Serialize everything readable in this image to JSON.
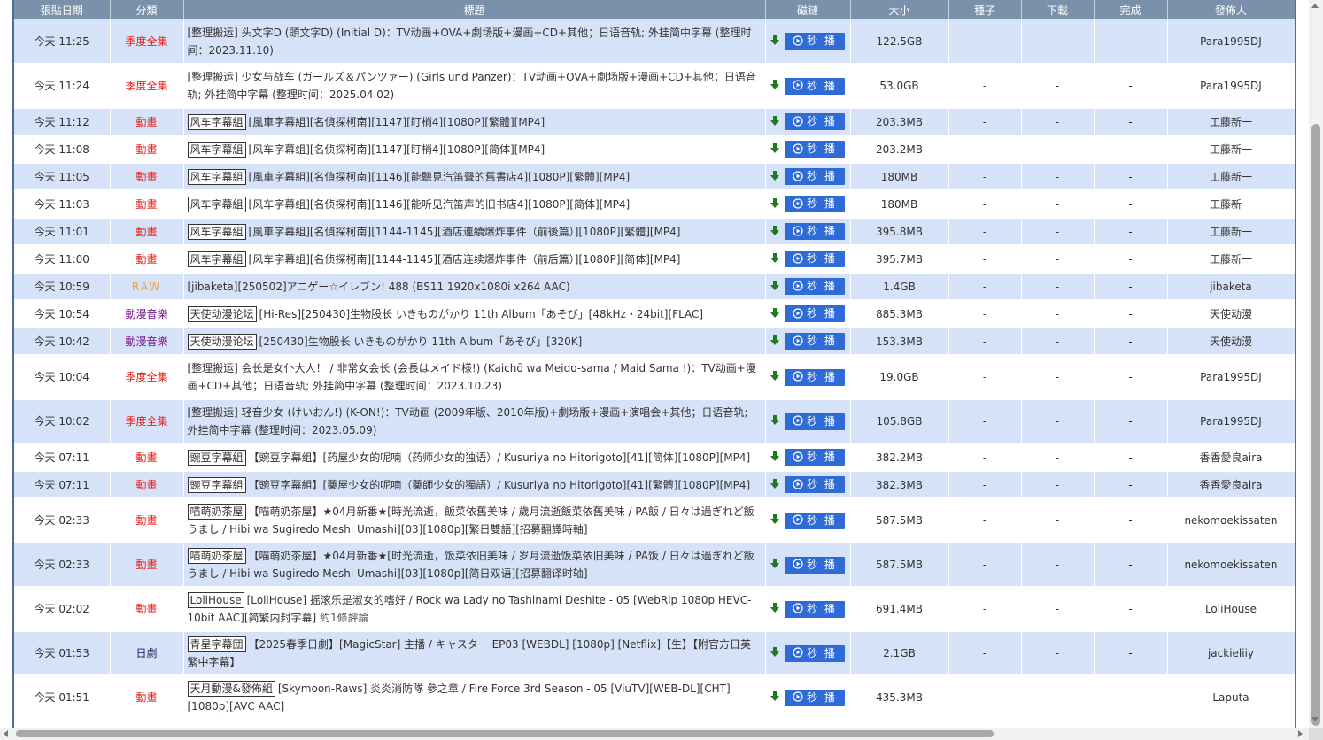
{
  "columns": {
    "date": "張貼日期",
    "category": "分類",
    "title": "標題",
    "magnet": "磁鏈",
    "size": "大小",
    "seeds": "種子",
    "downloads": "下載",
    "completed": "完成",
    "publisher": "發佈人"
  },
  "play_label": "秒 播",
  "colors": {
    "header_bg": "#7b91ab",
    "row_odd": "#d6e2f7",
    "row_even": "#ffffff",
    "category_red": "#e8201b",
    "category_raw": "#f0a040",
    "category_purple": "#7a1a8a",
    "play_button": "#2f6bd6",
    "download_icon": "#1f7a1f"
  },
  "icons": {
    "download": "download-arrow-icon",
    "play": "play-circle-icon"
  },
  "rows": [
    {
      "date": "今天 11:25",
      "category": "季度全集",
      "cat_style": "red",
      "tag": "",
      "title": "[整理搬运] 头文字D (頭文字D) (Initial D)：TV动画+OVA+劇场版+漫画+CD+其他；日语音轨; 外挂简中字幕 (整理时间：2023.11.10)",
      "size": "122.5GB",
      "seeds": "-",
      "downloads": "-",
      "completed": "-",
      "publisher": "Para1995DJ",
      "h": 50
    },
    {
      "date": "今天 11:24",
      "category": "季度全集",
      "cat_style": "red",
      "tag": "",
      "title": "[整理搬运] 少女与战车 (ガールズ＆パンツァー) (Girls und Panzer)：TV动画+OVA+劇场版+漫画+CD+其他；日语音轨; 外挂简中字幕 (整理时间：2025.04.02)",
      "size": "53.0GB",
      "seeds": "-",
      "downloads": "-",
      "completed": "-",
      "publisher": "Para1995DJ",
      "h": 50
    },
    {
      "date": "今天 11:12",
      "category": "動畫",
      "cat_style": "red",
      "tag": "风车字幕組",
      "title": "[風車字幕組][名偵探柯南][1147][盯梢4][1080P][繁體][MP4]",
      "size": "203.3MB",
      "seeds": "-",
      "downloads": "-",
      "completed": "-",
      "publisher": "工藤新一",
      "h": 31
    },
    {
      "date": "今天 11:08",
      "category": "動畫",
      "cat_style": "red",
      "tag": "风车字幕組",
      "title": "[风车字幕组][名侦探柯南][1147][盯梢4][1080P][简体][MP4]",
      "size": "203.2MB",
      "seeds": "-",
      "downloads": "-",
      "completed": "-",
      "publisher": "工藤新一",
      "h": 31
    },
    {
      "date": "今天 11:05",
      "category": "動畫",
      "cat_style": "red",
      "tag": "风车字幕組",
      "title": "[風車字幕組][名偵探柯南][1146][能聽見汽笛聲的舊書店4][1080P][繁體][MP4]",
      "size": "180MB",
      "seeds": "-",
      "downloads": "-",
      "completed": "-",
      "publisher": "工藤新一",
      "h": 31
    },
    {
      "date": "今天 11:03",
      "category": "動畫",
      "cat_style": "red",
      "tag": "风车字幕組",
      "title": "[风车字幕组][名侦探柯南][1146][能听见汽笛声的旧书店4][1080P][简体][MP4]",
      "size": "180MB",
      "seeds": "-",
      "downloads": "-",
      "completed": "-",
      "publisher": "工藤新一",
      "h": 31
    },
    {
      "date": "今天 11:01",
      "category": "動畫",
      "cat_style": "red",
      "tag": "风车字幕組",
      "title": "[風車字幕組][名偵探柯南][1144-1145][酒店連續爆炸事件（前後篇）][1080P][繁體][MP4]",
      "size": "395.8MB",
      "seeds": "-",
      "downloads": "-",
      "completed": "-",
      "publisher": "工藤新一",
      "h": 31
    },
    {
      "date": "今天 11:00",
      "category": "動畫",
      "cat_style": "red",
      "tag": "风车字幕組",
      "title": "[风车字幕组][名侦探柯南][1144-1145][酒店连续爆炸事件（前后篇）][1080P][简体][MP4]",
      "size": "395.7MB",
      "seeds": "-",
      "downloads": "-",
      "completed": "-",
      "publisher": "工藤新一",
      "h": 31
    },
    {
      "date": "今天 10:59",
      "category": "RAW",
      "cat_style": "raw",
      "tag": "",
      "title": "[jibaketa][250502]アニゲー☆イレブン! 488 (BS11 1920x1080i x264 AAC)",
      "size": "1.4GB",
      "seeds": "-",
      "downloads": "-",
      "completed": "-",
      "publisher": "jibaketa",
      "h": 31
    },
    {
      "date": "今天 10:54",
      "category": "動漫音樂",
      "cat_style": "purple",
      "tag": "天使动漫论坛",
      "title": "[Hi-Res][250430]生物股长 いきものがかり 11th Album「あそび」[48kHz・24bit][FLAC]",
      "size": "885.3MB",
      "seeds": "-",
      "downloads": "-",
      "completed": "-",
      "publisher": "天使动漫",
      "h": 31
    },
    {
      "date": "今天 10:42",
      "category": "動漫音樂",
      "cat_style": "purple",
      "tag": "天使动漫论坛",
      "title": "[250430]生物股长 いきものがかり 11th Album「あそび」[320K]",
      "size": "153.3MB",
      "seeds": "-",
      "downloads": "-",
      "completed": "-",
      "publisher": "天使动漫",
      "h": 31
    },
    {
      "date": "今天 10:04",
      "category": "季度全集",
      "cat_style": "red",
      "tag": "",
      "title": "[整理搬运] 会长是女仆大人！ / 非常女会长 (会長はメイド様!) (Kaichō wa Meido-sama / Maid Sama !)：TV动画+漫画+CD+其他；日语音轨; 外挂简中字幕 (整理时间：2023.10.23)",
      "size": "19.0GB",
      "seeds": "-",
      "downloads": "-",
      "completed": "-",
      "publisher": "Para1995DJ",
      "h": 50
    },
    {
      "date": "今天 10:02",
      "category": "季度全集",
      "cat_style": "red",
      "tag": "",
      "title": "[整理搬运] 轻音少女 (けいおん!) (K-ON!)：TV动画 (2009年版、2010年版)+劇场版+漫画+演唱会+其他；日语音轨; 外挂简中字幕 (整理时间：2023.05.09)",
      "size": "105.8GB",
      "seeds": "-",
      "downloads": "-",
      "completed": "-",
      "publisher": "Para1995DJ",
      "h": 50
    },
    {
      "date": "今天 07:11",
      "category": "動畫",
      "cat_style": "red",
      "tag": "豌豆字幕組",
      "title": "【豌豆字幕组】[药屋少女的呢喃（药师少女的独语）/ Kusuriya no Hitorigoto][41][简体][1080P][MP4]",
      "size": "382.2MB",
      "seeds": "-",
      "downloads": "-",
      "completed": "-",
      "publisher": "香香愛良aira",
      "h": 31
    },
    {
      "date": "今天 07:11",
      "category": "動畫",
      "cat_style": "red",
      "tag": "豌豆字幕組",
      "title": "【豌豆字幕組】[藥屋少女的呢喃（藥師少女的獨語）/ Kusuriya no Hitorigoto][41][繁體][1080P][MP4]",
      "size": "382.3MB",
      "seeds": "-",
      "downloads": "-",
      "completed": "-",
      "publisher": "香香愛良aira",
      "h": 31
    },
    {
      "date": "今天 02:33",
      "category": "動畫",
      "cat_style": "red",
      "tag": "喵萌奶茶屋",
      "title": "【喵萌奶茶屋】★04月新番★[時光流逝，飯菜依舊美味 / 歲月流逝飯菜依舊美味 / PA飯 / 日々は過ぎれど飯うまし / Hibi wa Sugiredo Meshi Umashi][03][1080p][繁日雙語][招募翻譯時軸]",
      "size": "587.5MB",
      "seeds": "-",
      "downloads": "-",
      "completed": "-",
      "publisher": "nekomoekissaten",
      "h": 50
    },
    {
      "date": "今天 02:33",
      "category": "動畫",
      "cat_style": "red",
      "tag": "喵萌奶茶屋",
      "title": "【喵萌奶茶屋】★04月新番★[时光流逝，饭菜依旧美味 / 岁月流逝饭菜依旧美味 / PA饭 / 日々は過ぎれど飯うまし / Hibi wa Sugiredo Meshi Umashi][03][1080p][简日双语][招募翻译时轴]",
      "size": "587.5MB",
      "seeds": "-",
      "downloads": "-",
      "completed": "-",
      "publisher": "nekomoekissaten",
      "h": 50
    },
    {
      "date": "今天 02:02",
      "category": "動畫",
      "cat_style": "red",
      "tag": "LoliHouse",
      "title": "[LoliHouse] 摇滚乐是淑女的嗜好 / Rock wa Lady no Tashinami Deshite - 05 [WebRip 1080p HEVC-10bit AAC][简繁内封字幕]",
      "comment": "約1條評論",
      "size": "691.4MB",
      "seeds": "-",
      "downloads": "-",
      "completed": "-",
      "publisher": "LoliHouse",
      "h": 50
    },
    {
      "date": "今天 01:53",
      "category": "日劇",
      "cat_style": "navy",
      "tag": "青星字幕団",
      "title": "【2025春季日劇】[MagicStar] 主播 / キャスター EP03 [WEBDL] [1080p] [Netflix]【生】【附官方日英繁中字幕】",
      "size": "2.1GB",
      "seeds": "-",
      "downloads": "-",
      "completed": "-",
      "publisher": "jackieliiy",
      "h": 50
    },
    {
      "date": "今天 01:51",
      "category": "動畫",
      "cat_style": "red",
      "tag": "天月動漫&發佈組",
      "title": "[Skymoon-Raws] 炎炎消防隊 參之章 / Fire Force 3rd Season - 05 [ViuTV][WEB-DL][CHT][1080p][AVC AAC]",
      "size": "435.3MB",
      "seeds": "-",
      "downloads": "-",
      "completed": "-",
      "publisher": "Laputa",
      "h": 50
    }
  ]
}
